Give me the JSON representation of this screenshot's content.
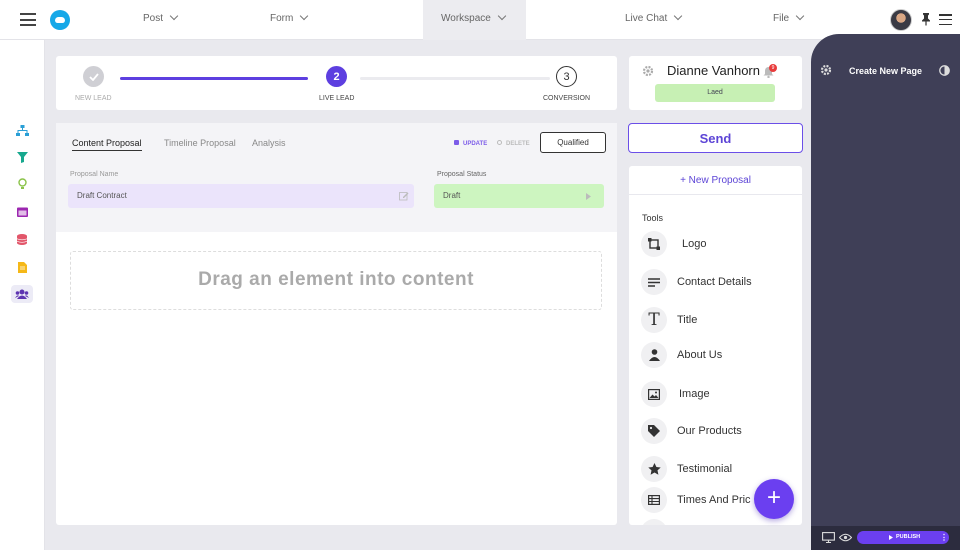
{
  "nav": {
    "items": [
      {
        "label": "Post"
      },
      {
        "label": "Form"
      },
      {
        "label": "Workspace"
      },
      {
        "label": "Live Chat"
      },
      {
        "label": "File"
      }
    ]
  },
  "stepper": {
    "steps": [
      {
        "number": "",
        "label": "NEW LEAD",
        "state": "done"
      },
      {
        "number": "2",
        "label": "LIVE LEAD",
        "state": "active"
      },
      {
        "number": "3",
        "label": "CONVERSION",
        "state": "pending"
      }
    ]
  },
  "contact": {
    "name": "Dianne Vanhorn",
    "badge": "Laed",
    "notifications": "9"
  },
  "send_label": "Send",
  "proposal": {
    "tabs": [
      "Content Proposal",
      "Timeline Proposal",
      "Analysis"
    ],
    "update_label": "UPDATE",
    "delete_label": "DELETE",
    "qualified_label": "Qualified",
    "name_label": "Proposal Name",
    "name_value": "Draft Contract",
    "status_label": "Proposal Status",
    "status_value": "Draft"
  },
  "drop_zone_text": "Drag an element into content",
  "tools": {
    "new_proposal_label": "+ New Proposal",
    "heading": "Tools",
    "items": [
      {
        "label": "Logo",
        "icon": "logo-crop-icon"
      },
      {
        "label": "Contact Details",
        "icon": "lines-icon"
      },
      {
        "label": "Title",
        "icon": "text-t-icon"
      },
      {
        "label": "About Us",
        "icon": "person-icon"
      },
      {
        "label": "Image",
        "icon": "image-icon"
      },
      {
        "label": "Our Products",
        "icon": "tag-icon"
      },
      {
        "label": "Testimonial",
        "icon": "star-icon"
      },
      {
        "label": "Times And Pric",
        "icon": "table-icon"
      }
    ]
  },
  "fab_label": "+",
  "page_panel": {
    "title": "Create New Page",
    "publish_label": "PUBLISH"
  },
  "colors": {
    "accent": "#6b3ff0",
    "dark_panel": "#3f3f57",
    "lead_badge": "#c7f0b4",
    "draft_field": "#cdf5c0",
    "name_field": "#ebe4fb"
  }
}
